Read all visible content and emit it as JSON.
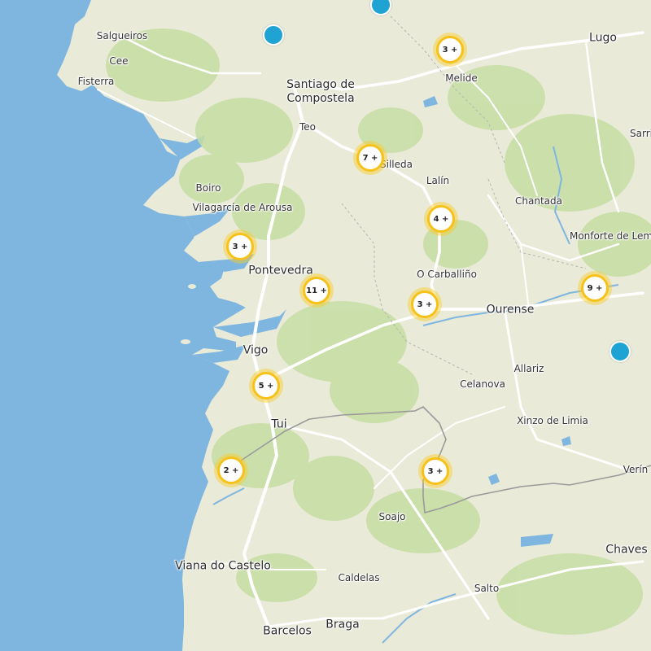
{
  "map": {
    "colors": {
      "water": "#7fb6e0",
      "land": "#e9ead8",
      "green": "#c6dea4",
      "road": "#ffffff",
      "border": "#9a9a9a",
      "cluster": "#f6c21a",
      "pin": "#1ea3d3"
    },
    "places": [
      {
        "id": "salgueiros",
        "name": "Salgueiros"
      },
      {
        "id": "cee",
        "name": "Cee"
      },
      {
        "id": "fisterra",
        "name": "Fisterra"
      },
      {
        "id": "santiago",
        "name": "Santiago de\nCompostela"
      },
      {
        "id": "melide",
        "name": "Melide"
      },
      {
        "id": "lugo",
        "name": "Lugo"
      },
      {
        "id": "teo",
        "name": "Teo"
      },
      {
        "id": "silleda",
        "name": "Silleda"
      },
      {
        "id": "sarria",
        "name": "Sarri"
      },
      {
        "id": "lalin",
        "name": "Lalín"
      },
      {
        "id": "boiro",
        "name": "Boiro"
      },
      {
        "id": "chantada",
        "name": "Chantada"
      },
      {
        "id": "vilagarcia",
        "name": "Vilagarcía de Arousa"
      },
      {
        "id": "monforte",
        "name": "Monforte de Lem"
      },
      {
        "id": "pontevedra",
        "name": "Pontevedra"
      },
      {
        "id": "carballino",
        "name": "O Carballiño"
      },
      {
        "id": "ourense",
        "name": "Ourense"
      },
      {
        "id": "vigo",
        "name": "Vigo"
      },
      {
        "id": "allariz",
        "name": "Allariz"
      },
      {
        "id": "celanova",
        "name": "Celanova"
      },
      {
        "id": "xinzo",
        "name": "Xinzo de Limia"
      },
      {
        "id": "tui",
        "name": "Tui"
      },
      {
        "id": "verin",
        "name": "Verín"
      },
      {
        "id": "soajo",
        "name": "Soajo"
      },
      {
        "id": "chaves",
        "name": "Chaves"
      },
      {
        "id": "viana",
        "name": "Viana do Castelo"
      },
      {
        "id": "caldelas",
        "name": "Caldelas"
      },
      {
        "id": "salto",
        "name": "Salto"
      },
      {
        "id": "barcelos",
        "name": "Barcelos"
      },
      {
        "id": "braga",
        "name": "Braga"
      }
    ],
    "clusters": [
      {
        "id": "melide",
        "count": 3,
        "label": "3 +"
      },
      {
        "id": "silleda",
        "count": 7,
        "label": "7 +"
      },
      {
        "id": "lalin",
        "count": 4,
        "label": "4 +"
      },
      {
        "id": "vilagarcia",
        "count": 3,
        "label": "3 +"
      },
      {
        "id": "pontevedra-east",
        "count": 11,
        "label": "11 +"
      },
      {
        "id": "carballino",
        "count": 3,
        "label": "3 +"
      },
      {
        "id": "monforte",
        "count": 9,
        "label": "9 +"
      },
      {
        "id": "vigo",
        "count": 5,
        "label": "5 +"
      },
      {
        "id": "coast",
        "count": 2,
        "label": "2 +"
      },
      {
        "id": "soajo",
        "count": 3,
        "label": "3 +"
      }
    ],
    "pins": [
      {
        "id": "top"
      },
      {
        "id": "north"
      },
      {
        "id": "east"
      }
    ]
  }
}
